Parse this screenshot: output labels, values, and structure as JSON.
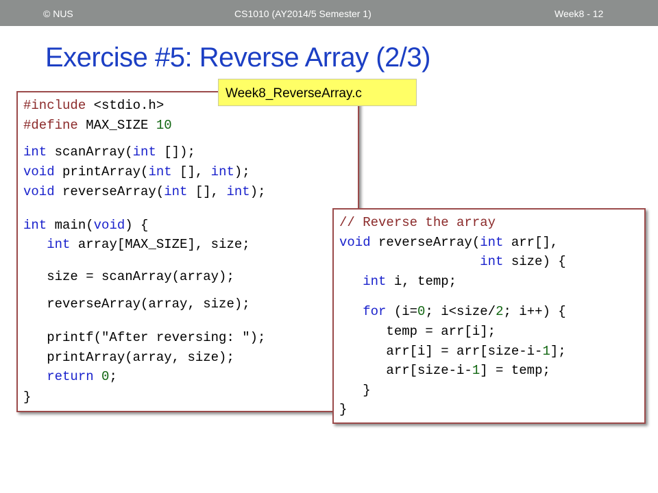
{
  "header": {
    "left": "© NUS",
    "center": "CS1010 (AY2014/5 Semester 1)",
    "right": "Week8 - 12"
  },
  "slide": {
    "title": "Exercise #5: Reverse Array (2/3)",
    "file_label": "Week8_ReverseArray.c"
  },
  "code_main": {
    "l1": "#include <stdio.h>",
    "l2": "#define MAX_SIZE 10",
    "l3": "int scanArray(int []);",
    "l4": "void printArray(int [], int);",
    "l5": "void reverseArray(int [], int);",
    "l6": "int main(void) {",
    "l7": "   int array[MAX_SIZE], size;",
    "l8": "   size = scanArray(array);",
    "l9": "   reverseArray(array, size);",
    "l10": "   printf(\"After reversing: \");",
    "l11": "   printArray(array, size);",
    "l12": "   return 0;",
    "l13": "}"
  },
  "code_reverse": {
    "l1": "// Reverse the array",
    "l2": "void reverseArray(int arr[],",
    "l3": "                  int size) {",
    "l4": "   int i, temp;",
    "l5": "   for (i=0; i<size/2; i++) {",
    "l6": "      temp = arr[i];",
    "l7": "      arr[i] = arr[size-i-1];",
    "l8": "      arr[size-i-1] = temp;",
    "l9": "   }",
    "l10": "}"
  },
  "colors": {
    "title": "#1c3fc4",
    "keyword": "#1a22cc",
    "preprocessor": "#8b2a2a",
    "number": "#116611",
    "comment": "#8b2a2a",
    "box_border": "#9b4a4a",
    "label_bg": "#ffff66",
    "topbar": "#8c8f8e"
  }
}
